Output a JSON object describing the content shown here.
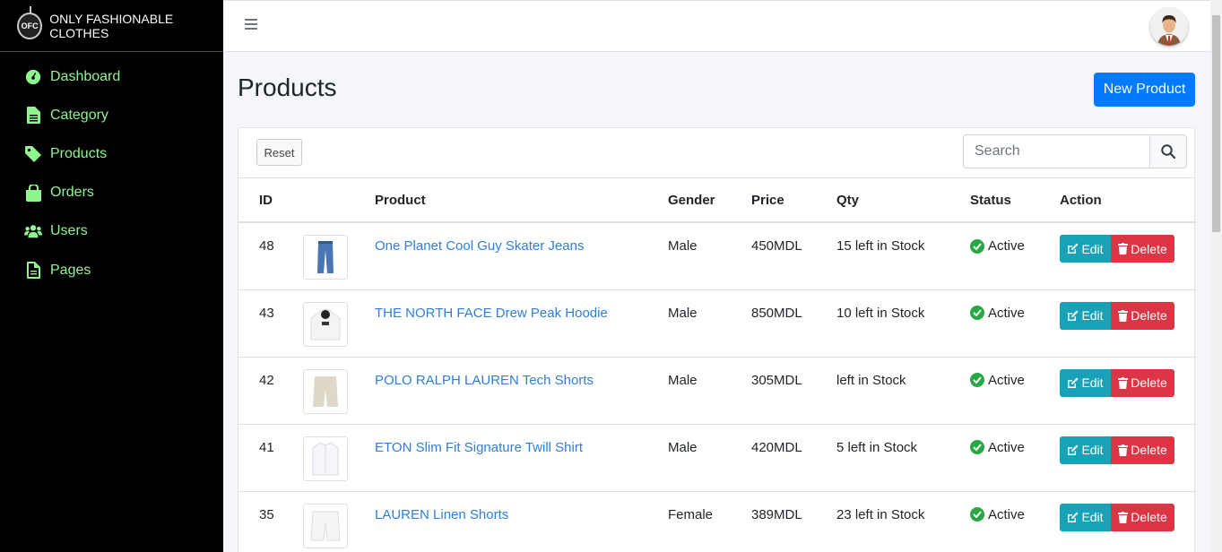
{
  "brand": {
    "logo_text": "OFC",
    "name": "ONLY FASHIONABLE CLOTHES"
  },
  "sidebar": {
    "items": [
      {
        "label": "Dashboard",
        "icon": "tachometer-icon"
      },
      {
        "label": "Category",
        "icon": "file-icon"
      },
      {
        "label": "Products",
        "icon": "tag-icon"
      },
      {
        "label": "Orders",
        "icon": "shopping-bag-icon"
      },
      {
        "label": "Users",
        "icon": "users-icon"
      },
      {
        "label": "Pages",
        "icon": "file-alt-icon"
      }
    ]
  },
  "page": {
    "title": "Products",
    "new_button": "New Product"
  },
  "toolbar": {
    "reset_label": "Reset",
    "search_placeholder": "Search"
  },
  "table": {
    "headers": [
      "ID",
      "",
      "Product",
      "Gender",
      "Price",
      "Qty",
      "Status",
      "Action"
    ],
    "rows": [
      {
        "id": "48",
        "product": "One Planet Cool Guy Skater Jeans",
        "gender": "Male",
        "price": "450MDL",
        "qty": "15 left in Stock",
        "status": "Active",
        "thumb": "jeans"
      },
      {
        "id": "43",
        "product": "THE NORTH FACE Drew Peak Hoodie",
        "gender": "Male",
        "price": "850MDL",
        "qty": "10 left in Stock",
        "status": "Active",
        "thumb": "hoodie"
      },
      {
        "id": "42",
        "product": "POLO RALPH LAUREN Tech Shorts",
        "gender": "Male",
        "price": "305MDL",
        "qty": "left in Stock",
        "status": "Active",
        "thumb": "shorts"
      },
      {
        "id": "41",
        "product": "ETON Slim Fit Signature Twill Shirt",
        "gender": "Male",
        "price": "420MDL",
        "qty": "5 left in Stock",
        "status": "Active",
        "thumb": "shirt"
      },
      {
        "id": "35",
        "product": "LAUREN Linen Shorts",
        "gender": "Female",
        "price": "389MDL",
        "qty": "23 left in Stock",
        "status": "Active",
        "thumb": "shorts-white"
      }
    ],
    "edit_label": "Edit",
    "delete_label": "Delete"
  },
  "colors": {
    "sidebar_bg": "#000000",
    "nav_text": "#8ff58f",
    "primary": "#007bff",
    "info": "#17a2b8",
    "danger": "#dc3545",
    "success": "#28a745",
    "link": "#2f7fd9"
  }
}
